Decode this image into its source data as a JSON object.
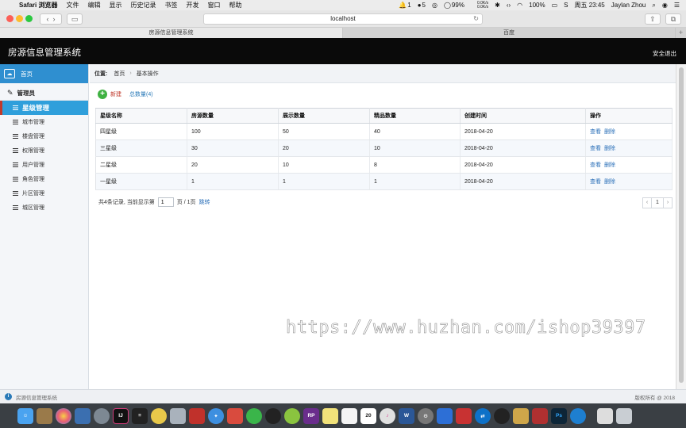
{
  "menubar": {
    "apple": "",
    "app": "Safari 浏览器",
    "items": [
      "文件",
      "编辑",
      "显示",
      "历史记录",
      "书签",
      "开发",
      "窗口",
      "帮助"
    ],
    "status": {
      "bell_count": "1",
      "count_5": "5",
      "battery": "99%",
      "net_up": "0.0K/s",
      "net_down": "0.0K/s",
      "battery2": "100%",
      "datetime": "周五 23:45",
      "user": "Jaylan Zhou"
    }
  },
  "browser": {
    "url": "localhost",
    "tabs": [
      {
        "label": "房源信息管理系统"
      },
      {
        "label": "百度"
      }
    ],
    "new_tab": "+"
  },
  "header": {
    "title": "房源信息管理系统",
    "logout": "安全退出"
  },
  "sidebar": {
    "home": "首页",
    "group": "管理员",
    "items": [
      {
        "label": "星级管理"
      },
      {
        "label": "城市管理"
      },
      {
        "label": "楼盘管理"
      },
      {
        "label": "权限管理"
      },
      {
        "label": "用户管理"
      },
      {
        "label": "角色管理"
      },
      {
        "label": "片区管理"
      },
      {
        "label": "城区管理"
      }
    ]
  },
  "breadcrumb": {
    "label": "位置:",
    "home": "首页",
    "current": "基本操作"
  },
  "toolbar": {
    "new_label": "新建",
    "count_label": "总数量(4)"
  },
  "table": {
    "headers": [
      "星级名称",
      "房源数量",
      "展示数量",
      "精品数量",
      "创建时间",
      "操作"
    ],
    "rows": [
      {
        "name": "四星级",
        "house": "100",
        "show": "50",
        "premium": "40",
        "date": "2018-04-20",
        "view": "查看",
        "del": "删除"
      },
      {
        "name": "三星级",
        "house": "30",
        "show": "20",
        "premium": "10",
        "date": "2018-04-20",
        "view": "查看",
        "del": "删除"
      },
      {
        "name": "二星级",
        "house": "20",
        "show": "10",
        "premium": "8",
        "date": "2018-04-20",
        "view": "查看",
        "del": "删除"
      },
      {
        "name": "一星级",
        "house": "1",
        "show": "1",
        "premium": "1",
        "date": "2018-04-20",
        "view": "查看",
        "del": "删除"
      }
    ]
  },
  "pager": {
    "summary": "共4条记录, 当前显示第",
    "page_value": "1",
    "page_total": "页 / 1页",
    "jump": "跳转",
    "prev": "‹",
    "current": "1",
    "next": "›"
  },
  "watermark": "https://www.huzhan.com/ishop39397",
  "footer": {
    "left": "房源信息管理系统",
    "right": "版权所有 @ 2018"
  },
  "dock": {
    "items": [
      "finder-icon",
      "launchpad-icon",
      "photos-icon",
      "preview-icon",
      "rocket-icon",
      "intellij-icon",
      "terminal-icon",
      "duck-icon",
      "storage-icon",
      "redis-icon",
      "safari-icon",
      "drop-icon",
      "wechat-icon",
      "qq-icon",
      "greenapp-icon",
      "axure-icon",
      "notes-icon",
      "textedit-icon",
      "calendar-icon",
      "itunes-icon",
      "word-icon",
      "system-prefs-icon",
      "baidu-icon",
      "xmind-icon",
      "teamviewer-icon",
      "qq2-icon",
      "archive-icon",
      "filezilla-icon",
      "photoshop-icon",
      "edge-icon",
      "folder-icon",
      "trash-icon"
    ],
    "calendar_day": "20",
    "intellij_label": "IJ",
    "axure_label": "RP",
    "word_label": "W",
    "photoshop_label": "Ps"
  }
}
